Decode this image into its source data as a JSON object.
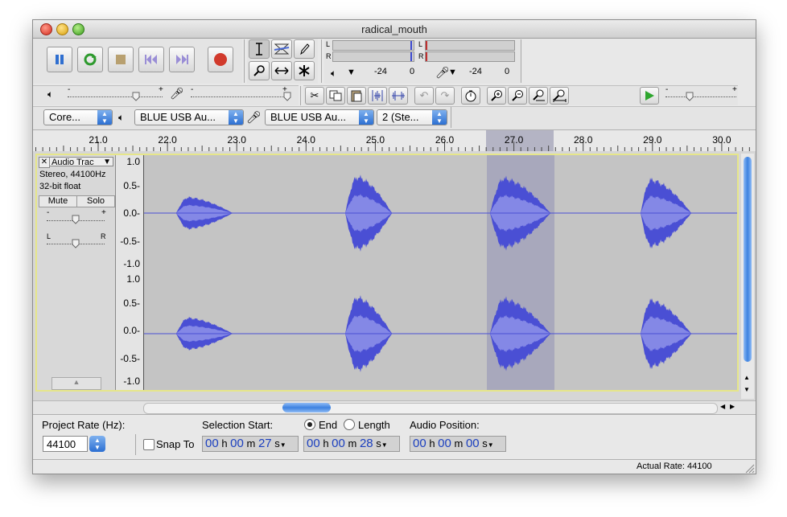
{
  "window": {
    "title": "radical_mouth"
  },
  "meters": {
    "left_label": "L",
    "right_label": "R",
    "play_db": "-24",
    "play_zero": "0",
    "rec_db": "-24",
    "rec_zero": "0"
  },
  "device_bar": {
    "host": "Core...",
    "playback_device": "BLUE USB Au...",
    "recording_device": "BLUE USB Au...",
    "channels": "2 (Ste..."
  },
  "ruler": {
    "ticks": [
      "21.0",
      "22.0",
      "23.0",
      "24.0",
      "25.0",
      "26.0",
      "27.0",
      "28.0",
      "29.0",
      "30.0"
    ]
  },
  "track": {
    "name": "Audio Trac",
    "info1": "Stereo, 44100Hz",
    "info2": "32-bit float",
    "mute": "Mute",
    "solo": "Solo",
    "gain_minus": "-",
    "gain_plus": "+",
    "pan_left": "L",
    "pan_right": "R",
    "scale": [
      "1.0",
      "0.5-",
      "0.0-",
      "-0.5-",
      "-1.0"
    ]
  },
  "bottom": {
    "project_rate_label": "Project Rate (Hz):",
    "project_rate_value": "44100",
    "snap_to": "Snap To",
    "selection_start_label": "Selection Start:",
    "end_label": "End",
    "length_label": "Length",
    "audio_position_label": "Audio Position:",
    "sel_start": {
      "h": "00",
      "m": "00",
      "s": "27"
    },
    "sel_end": {
      "h": "00",
      "m": "00",
      "s": "28"
    },
    "audio_pos": {
      "h": "00",
      "m": "00",
      "s": "00"
    },
    "unit_h": "h",
    "unit_m": "m",
    "unit_s": "s"
  },
  "status": {
    "actual_rate": "Actual Rate: 44100"
  },
  "colors": {
    "wave_dark": "#4a4fd4",
    "wave_light": "#8488e6",
    "selection": "#a8a8bc",
    "track_bg": "#c4c4c4"
  }
}
